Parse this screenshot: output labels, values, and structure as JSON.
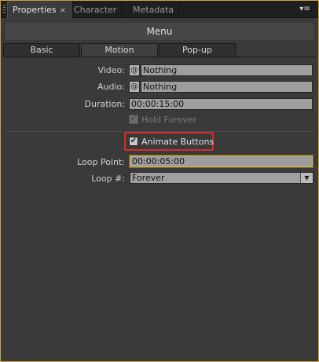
{
  "tabs": [
    {
      "label": "Properties",
      "active": true
    },
    {
      "label": "Character",
      "active": false
    },
    {
      "label": "Metadata",
      "active": false
    }
  ],
  "icons": {
    "tab_close": "×",
    "panel_menu": "▾≡",
    "picker": "@",
    "check": "✔",
    "dropdown_arrow": "▼"
  },
  "section": {
    "title": "Menu"
  },
  "subtabs": [
    {
      "label": "Basic"
    },
    {
      "label": "Motion",
      "active": true
    },
    {
      "label": "Pop-up"
    }
  ],
  "fields": {
    "video": {
      "label": "Video:",
      "value": "Nothing"
    },
    "audio": {
      "label": "Audio:",
      "value": "Nothing"
    },
    "duration": {
      "label": "Duration:",
      "value": "00:00:15:00"
    },
    "hold_forever": {
      "label": "Hold Forever",
      "checked": true,
      "disabled": true
    },
    "animate_buttons": {
      "label": "Animate Buttons",
      "checked": true
    },
    "loop_point": {
      "label": "Loop Point:",
      "value": "00:00:05:00"
    },
    "loop_count": {
      "label": "Loop #:",
      "value": "Forever"
    }
  },
  "colors": {
    "accent_border": "#c8a545",
    "highlight": "#d92b2b"
  }
}
